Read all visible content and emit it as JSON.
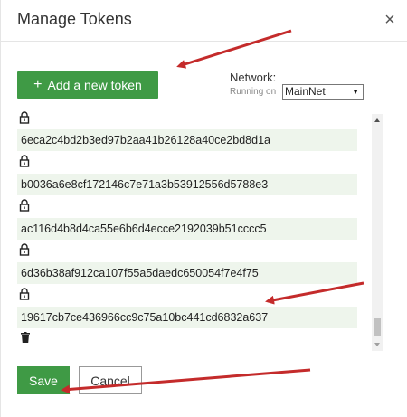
{
  "dialog": {
    "title": "Manage Tokens",
    "close_glyph": "×"
  },
  "toolbar": {
    "add_plus": "+",
    "add_label": "Add a new token"
  },
  "network": {
    "label": "Network:",
    "running_on": "Running on",
    "selected": "MainNet"
  },
  "tokens": [
    {
      "address": "6eca2c4bd2b3ed97b2aa41b26128a40ce2bd8d1a",
      "icon": "lock-icon"
    },
    {
      "address": "b0036a6e8cf172146c7e71a3b53912556d5788e3",
      "icon": "lock-icon"
    },
    {
      "address": "ac116d4b8d4ca55e6b6d4ecce2192039b51cccc5",
      "icon": "lock-icon"
    },
    {
      "address": "6d36b38af912ca107f55a5daedc650054f7e4f75",
      "icon": "lock-icon"
    },
    {
      "address": "19617cb7ce436966cc9c75a10bc441cd6832a637",
      "icon": "lock-icon"
    }
  ],
  "footer": {
    "save_label": "Save",
    "cancel_label": "Cancel"
  },
  "colors": {
    "primary_green": "#3f9a45",
    "row_background": "#eef5ec",
    "annotation_arrow": "#c42b2b"
  }
}
